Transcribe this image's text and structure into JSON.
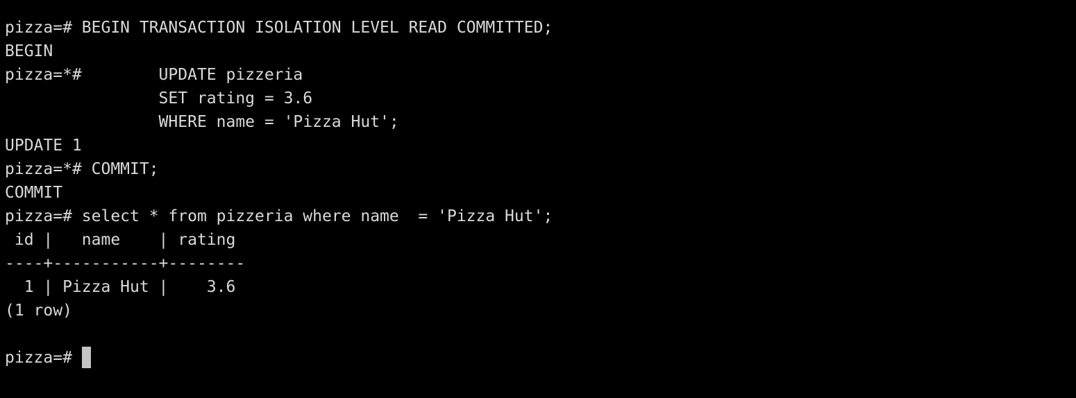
{
  "terminal": {
    "lines": [
      "pizza=# BEGIN TRANSACTION ISOLATION LEVEL READ COMMITTED;",
      "BEGIN",
      "pizza=*#        UPDATE pizzeria",
      "                SET rating = 3.6",
      "                WHERE name = 'Pizza Hut';",
      "UPDATE 1",
      "pizza=*# COMMIT;",
      "COMMIT",
      "pizza=# select * from pizzeria where name  = 'Pizza Hut';",
      " id |   name    | rating",
      "----+-----------+--------",
      "  1 | Pizza Hut |    3.6",
      "(1 row)",
      "",
      "pizza=# "
    ]
  },
  "colors": {
    "background": "#000000",
    "text": "#d9d9d9",
    "cursor": "#c4c4c4"
  }
}
